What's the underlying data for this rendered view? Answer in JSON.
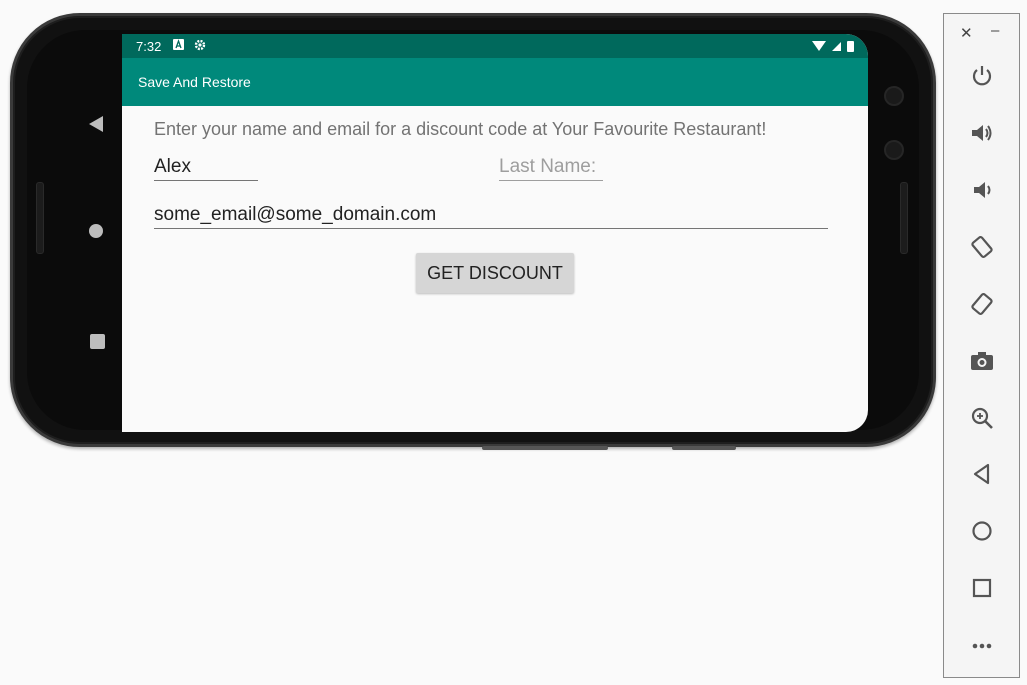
{
  "status_bar": {
    "time": "7:32",
    "left_icons": [
      "a-icon",
      "gear-icon"
    ],
    "right_icons": [
      "wifi-icon",
      "signal-icon",
      "battery-icon"
    ]
  },
  "app_bar": {
    "title": "Save And Restore"
  },
  "main": {
    "prompt": "Enter your name and email for a discount code at Your Favourite Restaurant!",
    "first_name": {
      "value": "Alex"
    },
    "last_name": {
      "value": "",
      "placeholder": "Last Name:"
    },
    "email": {
      "value": "some_email@some_domain.com"
    },
    "discount_button": "GET DISCOUNT"
  },
  "colors": {
    "status_bar": "#00695c",
    "app_bar": "#00897b",
    "button": "#d6d6d6"
  },
  "device_nav": [
    "back-icon",
    "home-icon",
    "recents-icon"
  ],
  "emulator_toolbar": {
    "window_controls": [
      "close-icon",
      "minimize-icon"
    ],
    "buttons": [
      "power-icon",
      "volume-up-icon",
      "volume-down-icon",
      "rotate-left-icon",
      "rotate-right-icon",
      "camera-icon",
      "zoom-icon",
      "back-icon",
      "home-icon",
      "overview-icon",
      "more-icon"
    ]
  }
}
